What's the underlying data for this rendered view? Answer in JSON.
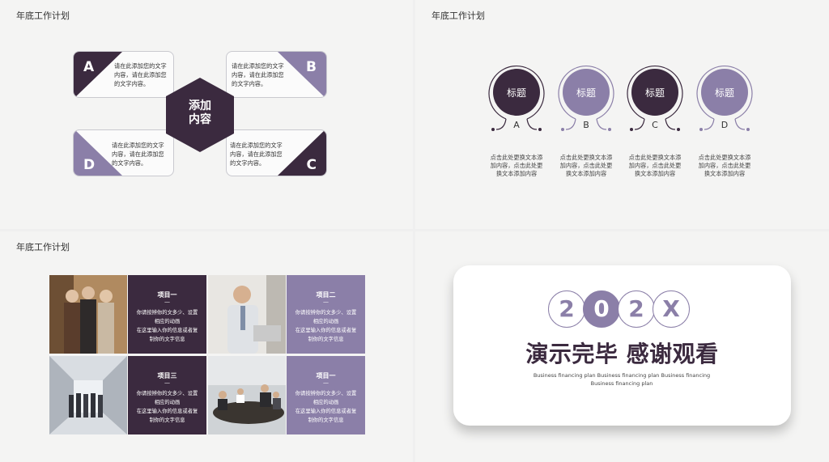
{
  "slide1": {
    "title": "年底工作计划",
    "center": [
      "添加",
      "内容"
    ],
    "cards": [
      {
        "letter": "A",
        "text": [
          "请在此添加您的文字",
          "内容，请在此添加您",
          "的文字内容。"
        ]
      },
      {
        "letter": "B",
        "text": [
          "请在此添加您的文字",
          "内容，请在此添加您",
          "的文字内容。"
        ]
      },
      {
        "letter": "D",
        "text": [
          "请在此添加您的文字",
          "内容，请在此添加您",
          "的文字内容。"
        ]
      },
      {
        "letter": "C",
        "text": [
          "请在此添加您的文字",
          "内容，请在此添加您",
          "的文字内容。"
        ]
      }
    ]
  },
  "slide2": {
    "title": "年底工作计划",
    "items": [
      {
        "title": "标题",
        "letter": "A",
        "desc": [
          "点击此处更换文本添",
          "加内容，点击此处更",
          "换文本添加内容"
        ]
      },
      {
        "title": "标题",
        "letter": "B",
        "desc": [
          "点击此处更换文本添",
          "加内容，点击此处更",
          "换文本添加内容"
        ]
      },
      {
        "title": "标题",
        "letter": "C",
        "desc": [
          "点击此处更换文本添",
          "加内容，点击此处更",
          "换文本添加内容"
        ]
      },
      {
        "title": "标题",
        "letter": "D",
        "desc": [
          "点击此处更换文本添",
          "加内容，点击此处更",
          "换文本添加内容"
        ]
      }
    ]
  },
  "slide3": {
    "title": "年底工作计划",
    "projects": [
      {
        "title": "项目一",
        "lines": [
          "你请按辨你的文多少、设置",
          "相应的动画",
          "在这里输入你的信息或者复",
          "制你的文字信息"
        ]
      },
      {
        "title": "项目二",
        "lines": [
          "你请按辨你的文多少、设置",
          "相应的动画",
          "在这里输入你的信息或者复",
          "制你的文字信息"
        ]
      },
      {
        "title": "项目三",
        "lines": [
          "你请按辨你的文多少、设置",
          "相应的动画",
          "在这里输入你的信息或者复",
          "制你的文字信息"
        ]
      },
      {
        "title": "项目一",
        "lines": [
          "你请按辨你的文多少、设置",
          "相应的动画",
          "在这里输入你的信息或者复",
          "制你的文字信息"
        ]
      }
    ]
  },
  "slide4": {
    "year": [
      "2",
      "0",
      "2",
      "X"
    ],
    "title": "演示完毕 感谢观看",
    "subtitle": [
      "Business financing plan Business financing plan Business financing",
      "Business financing plan"
    ]
  },
  "colors": {
    "dark": "#3b2a3f",
    "light": "#8b7fa8"
  }
}
